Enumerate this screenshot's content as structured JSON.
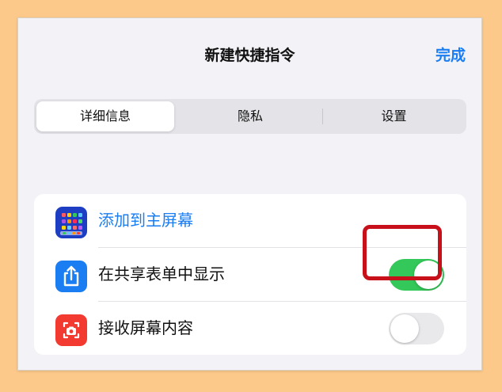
{
  "header": {
    "title": "新建快捷指令",
    "done_label": "完成"
  },
  "tabs": [
    {
      "label": "详细信息",
      "active": true
    },
    {
      "label": "隐私",
      "active": false
    },
    {
      "label": "设置",
      "active": false
    }
  ],
  "settings": [
    {
      "label": "添加到主屏幕",
      "icon": "home-screen-grid-icon",
      "type": "link"
    },
    {
      "label": "在共享表单中显示",
      "icon": "share-icon",
      "type": "toggle",
      "on": true,
      "icon_color": "#1a7ef2"
    },
    {
      "label": "接收屏幕内容",
      "icon": "screenshot-icon",
      "type": "toggle",
      "on": false,
      "icon_color": "#f23a30"
    }
  ],
  "colors": {
    "accent": "#1a7ef2",
    "toggle_on": "#34c759",
    "toggle_off": "#e9e9eb",
    "highlight": "#c8101a"
  }
}
